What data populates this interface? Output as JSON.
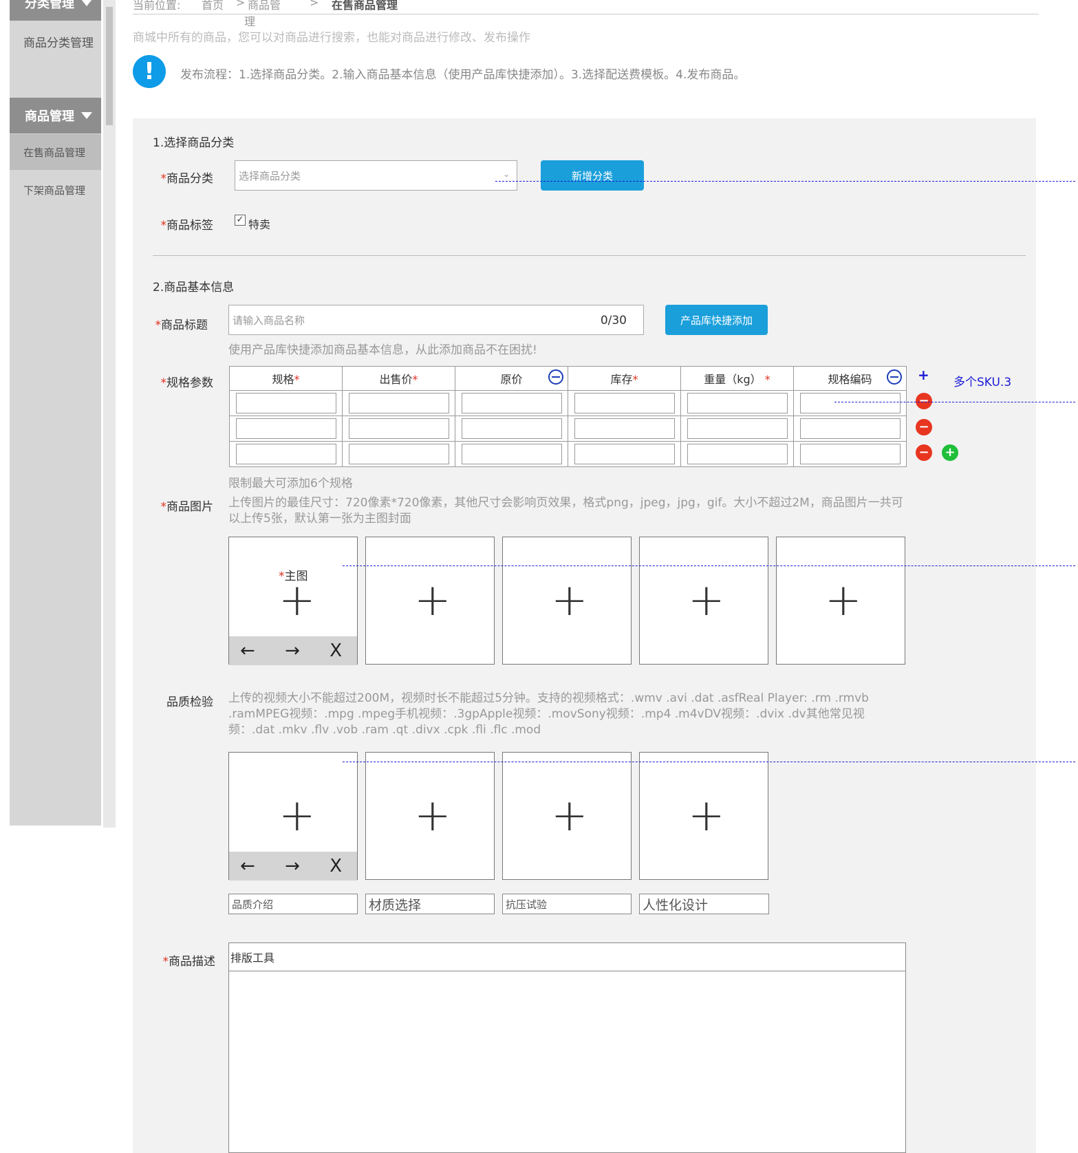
{
  "sidebar": {
    "category_mgmt_header": "分类管理",
    "category_mgmt_item": "商品分类管理",
    "goods_mgmt_header": "商品管理",
    "items": [
      "在售商品管理",
      "下架商品管理"
    ]
  },
  "header": {
    "location_label": "当前位置:",
    "crumb_home": "首页",
    "crumb_sep": ">",
    "crumb_goods": "商品管",
    "crumb_goods_wrap": "理",
    "crumb_current": "在售商品管理",
    "description": "商城中所有的商品，您可以对商品进行搜索，也能对商品进行修改、发布操作",
    "flow_text": "发布流程：1.选择商品分类。2.输入商品基本信息（使用产品库快捷添加）。3.选择配送费模板。4.发布商品。"
  },
  "section1": {
    "title": "1.选择商品分类",
    "category_label": "商品分类",
    "category_placeholder": "选择商品分类",
    "add_category_button": "新增分类",
    "tag_label": "商品标签",
    "tag_option": "特卖",
    "tag_checked": true
  },
  "section2": {
    "title": "2.商品基本信息",
    "title_label": "商品标题",
    "title_placeholder": "请输入商品名称",
    "title_counter": "0/30",
    "quick_add_button": "产品库快捷添加",
    "quick_add_hint": "使用产品库快捷添加商品基本信息，从此添加商品不在困扰!",
    "spec_label": "规格参数",
    "spec_columns": [
      "规格",
      "出售价",
      "原价",
      "库存",
      "重量（kg）",
      "规格编码"
    ],
    "spec_required": [
      true,
      true,
      false,
      true,
      true,
      false
    ],
    "multi_sku_note": "多个SKU.3",
    "spec_limit_hint": "限制最大可添加6个规格",
    "image_label": "商品图片",
    "image_hint": "上传图片的最佳尺寸：720像素*720像素，其他尺寸会影响页效果，格式png，jpeg，jpg，gif。大小不超过2M，商品图片一共可以上传5张，默认第一张为主图封面",
    "main_image_label": "主图",
    "quality_label": "品质检验",
    "video_hint": "上传的视频大小不能超过200M，视频时长不能超过5分钟。支持的视频格式：.wmv .avi .dat .asfReal Player: .rm .rmvb .ramMPEG视频：.mpg .mpeg手机视频：.3gpApple视频：.movSony视频：.mp4 .m4vDV视频：.dvix .dv其他常见视频：.dat .mkv .flv .vob .ram .qt .divx .cpk .fli .flc .mod",
    "video_captions": [
      "品质介绍",
      "材质选择",
      "抗压试验",
      "人性化设计"
    ],
    "desc_label": "商品描述",
    "editor_toolbar": "排版工具",
    "arrow_left": "←",
    "arrow_right": "→",
    "delete_x": "X"
  }
}
